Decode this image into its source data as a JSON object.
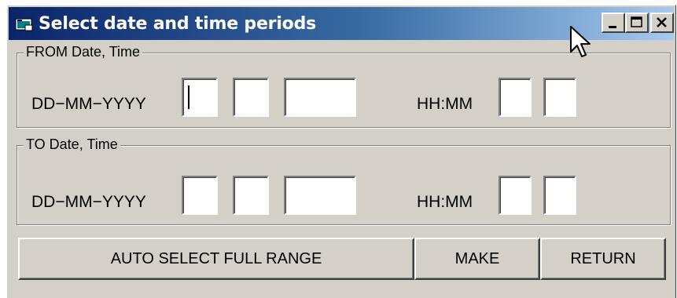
{
  "window": {
    "title": "Select date and time periods"
  },
  "from_group": {
    "legend": "FROM Date, Time",
    "date_label": "DD−MM−YYYY",
    "time_label": "HH:MM",
    "day_value": "",
    "month_value": "",
    "year_value": "",
    "hour_value": "",
    "minute_value": ""
  },
  "to_group": {
    "legend": "TO Date, Time",
    "date_label": "DD−MM−YYYY",
    "time_label": "HH:MM",
    "day_value": "",
    "month_value": "",
    "year_value": "",
    "hour_value": "",
    "minute_value": ""
  },
  "buttons": {
    "auto_select": "AUTO SELECT FULL RANGE",
    "make": "MAKE",
    "return": "RETURN"
  },
  "colors": {
    "title_gradient_start": "#0a246a",
    "title_gradient_end": "#a6caf0",
    "face": "#d4d0c8"
  }
}
